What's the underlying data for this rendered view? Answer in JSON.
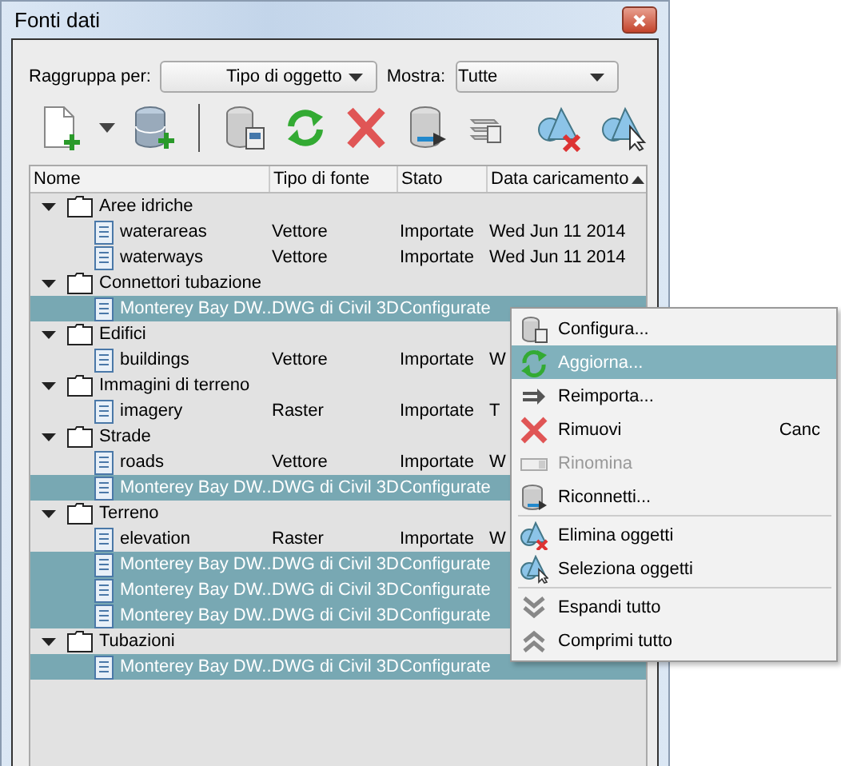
{
  "window": {
    "title": "Fonti dati"
  },
  "filters": [
    {
      "label": "Raggruppa per:",
      "value": "Tipo di oggetto"
    },
    {
      "label": "Mostra:",
      "value": "Tutte"
    }
  ],
  "table": {
    "columns": [
      "Nome",
      "Tipo di fonte",
      "Stato",
      "Data caricamento"
    ],
    "groups": [
      {
        "label": "Aree idriche",
        "expanded": true,
        "rows": [
          {
            "name": "waterareas",
            "type": "Vettore",
            "state": "Importate",
            "date": "Wed Jun 11 2014",
            "selected": false
          },
          {
            "name": "waterways",
            "type": "Vettore",
            "state": "Importate",
            "date": "Wed Jun 11 2014",
            "selected": false
          }
        ]
      },
      {
        "label": "Connettori tubazione",
        "expanded": true,
        "rows": [
          {
            "name": "Monterey Bay DW...",
            "type": "DWG di Civil 3D",
            "state": "Configurate",
            "selected": true
          }
        ]
      },
      {
        "label": "Edifici",
        "expanded": true,
        "rows": [
          {
            "name": "buildings",
            "type": "Vettore",
            "state": "Importate",
            "date": "W",
            "selected": false
          }
        ]
      },
      {
        "label": "Immagini di terreno",
        "expanded": true,
        "rows": [
          {
            "name": "imagery",
            "type": "Raster",
            "state": "Importate",
            "date": "T",
            "selected": false
          }
        ]
      },
      {
        "label": "Strade",
        "expanded": true,
        "rows": [
          {
            "name": "roads",
            "type": "Vettore",
            "state": "Importate",
            "date": "W",
            "selected": false
          },
          {
            "name": "Monterey Bay DW...",
            "type": "DWG di Civil 3D",
            "state": "Configurate",
            "selected": true
          }
        ]
      },
      {
        "label": "Terreno",
        "expanded": true,
        "rows": [
          {
            "name": "elevation",
            "type": "Raster",
            "state": "Importate",
            "date": "W",
            "selected": false
          },
          {
            "name": "Monterey Bay DW...",
            "type": "DWG di Civil 3D",
            "state": "Configurate",
            "selected": true
          },
          {
            "name": "Monterey Bay DW...",
            "type": "DWG di Civil 3D",
            "state": "Configurate",
            "selected": true
          },
          {
            "name": "Monterey Bay DW...",
            "type": "DWG di Civil 3D",
            "state": "Configurate",
            "selected": true
          }
        ]
      },
      {
        "label": "Tubazioni",
        "expanded": true,
        "rows": [
          {
            "name": "Monterey Bay DW...",
            "type": "DWG di Civil 3D",
            "state": "Configurate",
            "selected": true
          }
        ]
      }
    ]
  },
  "context_menu": {
    "sections": [
      [
        {
          "kind": "configure",
          "label": "Configura...",
          "selected": false,
          "disabled": false
        },
        {
          "kind": "refresh",
          "label": "Aggiorna...",
          "selected": true,
          "disabled": false
        },
        {
          "kind": "reimport",
          "label": "Reimporta...",
          "selected": false,
          "disabled": false
        },
        {
          "kind": "remove",
          "label": "Rimuovi",
          "shortcut": "Canc",
          "selected": false,
          "disabled": false
        },
        {
          "kind": "rename",
          "label": "Rinomina",
          "selected": false,
          "disabled": true
        },
        {
          "kind": "reconnect",
          "label": "Riconnetti...",
          "selected": false,
          "disabled": false
        }
      ],
      [
        {
          "kind": "erase",
          "label": "Elimina oggetti",
          "selected": false,
          "disabled": false
        },
        {
          "kind": "select",
          "label": "Seleziona oggetti",
          "selected": false,
          "disabled": false
        }
      ],
      [
        {
          "kind": "expand",
          "label": "Espandi tutto",
          "selected": false,
          "disabled": false
        },
        {
          "kind": "collapse",
          "label": "Comprimi tutto",
          "selected": false,
          "disabled": false
        }
      ]
    ]
  }
}
